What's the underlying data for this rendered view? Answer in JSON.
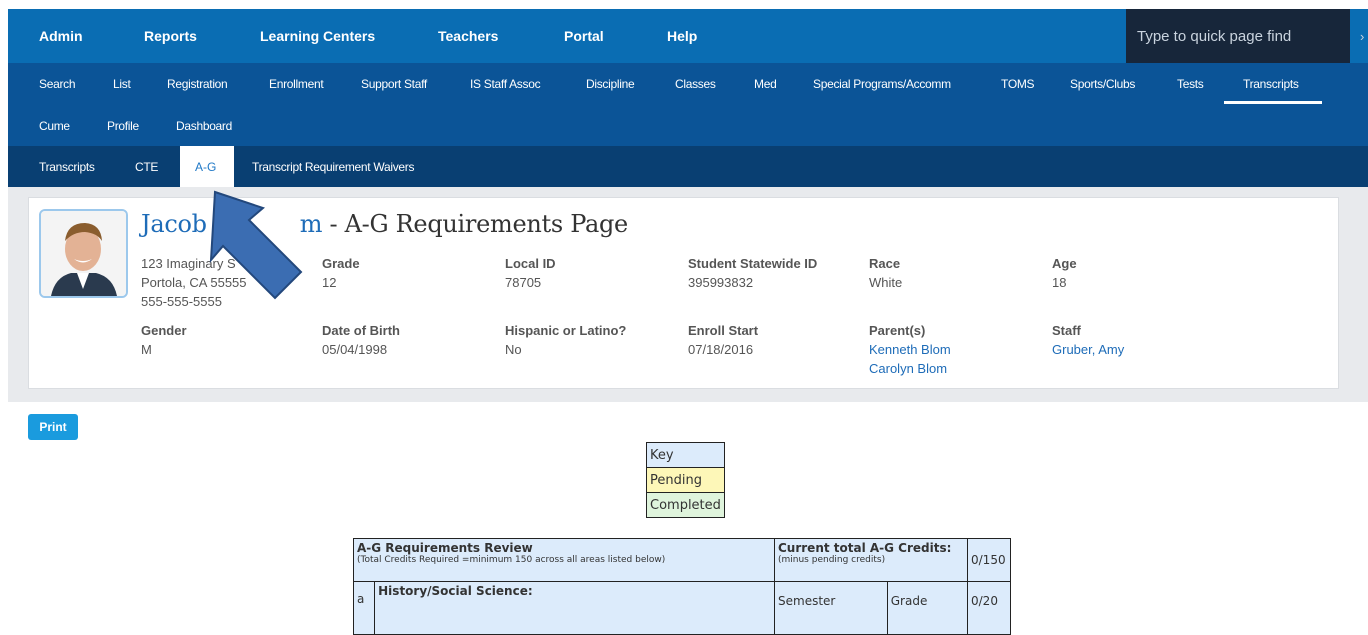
{
  "topnav": {
    "items": [
      {
        "label": "Admin"
      },
      {
        "label": "Reports"
      },
      {
        "label": "Learning Centers"
      },
      {
        "label": "Teachers"
      },
      {
        "label": "Portal"
      },
      {
        "label": "Help"
      }
    ],
    "search_placeholder": "Type to quick page find"
  },
  "subnav": {
    "items": [
      {
        "label": "Search"
      },
      {
        "label": "List"
      },
      {
        "label": "Registration"
      },
      {
        "label": "Enrollment"
      },
      {
        "label": "Support Staff"
      },
      {
        "label": "IS Staff Assoc"
      },
      {
        "label": "Discipline"
      },
      {
        "label": "Classes"
      },
      {
        "label": "Med"
      },
      {
        "label": "Special Programs/Accomm"
      },
      {
        "label": "TOMS"
      },
      {
        "label": "Sports/Clubs"
      },
      {
        "label": "Tests"
      },
      {
        "label": "Transcripts"
      },
      {
        "label": "Cume"
      },
      {
        "label": "Profile"
      },
      {
        "label": "Dashboard"
      }
    ]
  },
  "tabs": {
    "items": [
      {
        "label": "Transcripts"
      },
      {
        "label": "CTE"
      },
      {
        "label": "A-G"
      },
      {
        "label": "Transcript Requirement Waivers"
      }
    ]
  },
  "student": {
    "name_visible": "Jacob",
    "name_tail": "m",
    "title_rest": " - A-G Requirements Page",
    "address1": "123 Imaginary S",
    "address2": "Portola, CA 55555",
    "phone": "555-555-5555",
    "fields": [
      {
        "label": "Grade",
        "value": "12"
      },
      {
        "label": "Local ID",
        "value": "78705"
      },
      {
        "label": "Student Statewide ID",
        "value": "395993832"
      },
      {
        "label": "Race",
        "value": "White"
      },
      {
        "label": "Age",
        "value": "18"
      },
      {
        "label": "Gender",
        "value": "M"
      },
      {
        "label": "Date of Birth",
        "value": "05/04/1998"
      },
      {
        "label": "Hispanic or Latino?",
        "value": "No"
      },
      {
        "label": "Enroll Start",
        "value": "07/18/2016"
      }
    ],
    "parents_label": "Parent(s)",
    "parents": [
      "Kenneth Blom",
      "Carolyn Blom"
    ],
    "staff_label": "Staff",
    "staff": "Gruber, Amy"
  },
  "print_label": "Print",
  "key": {
    "title": "Key",
    "pending": "Pending",
    "completed": "Completed",
    "colors": {
      "title": "#dcebfb",
      "pending": "#fdf7b8",
      "completed": "#dff4dc"
    }
  },
  "review": {
    "title": "A-G Requirements Review",
    "subtitle": "(Total Credits Required =minimum 150 across all areas listed below)",
    "credits_label": "Current total A-G Credits:",
    "credits_sub": "(minus pending credits)",
    "credits_value": "0/150",
    "row_letter": "a",
    "row_title": "History/Social Science:",
    "semester": "Semester",
    "grade": "Grade",
    "row_value": "0/20"
  }
}
